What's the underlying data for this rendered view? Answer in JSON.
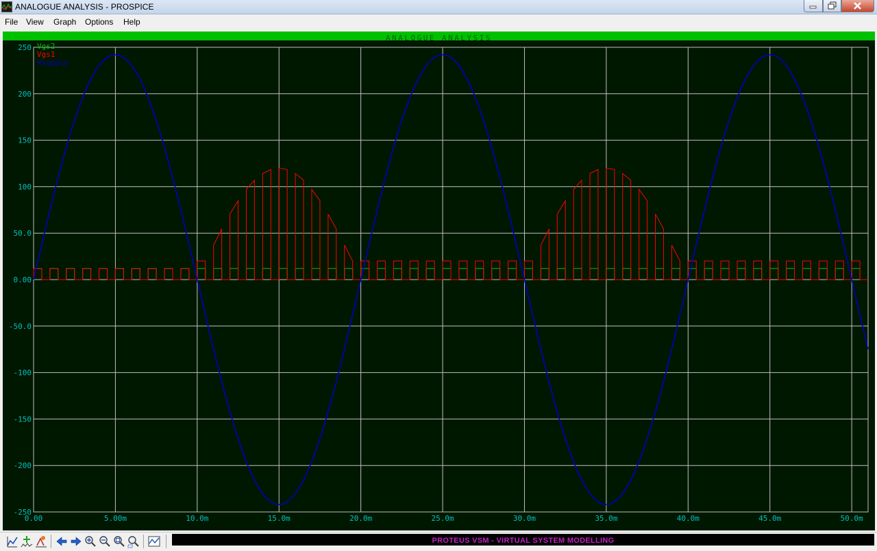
{
  "window": {
    "title": "ANALOGUE ANALYSIS - PROSPICE",
    "controls": [
      "minimize",
      "maximize",
      "close"
    ]
  },
  "menu": [
    "File",
    "View",
    "Graph",
    "Options",
    "Help"
  ],
  "graph": {
    "header_title": "ANALOGUE ANALYSIS",
    "background_color": "#001800",
    "grid_color": "#c0c0c0",
    "axis_label_color": "#00c0c0"
  },
  "chart_data": {
    "type": "line",
    "title": "ANALOGUE ANALYSIS",
    "xlabel": "",
    "ylabel": "",
    "xlim": [
      0,
      0.051
    ],
    "ylim": [
      -250,
      250
    ],
    "grid": true,
    "legend_position": "top-left",
    "x_tick_values": [
      0,
      0.005,
      0.01,
      0.015,
      0.02,
      0.025,
      0.03,
      0.035,
      0.04,
      0.045,
      0.05
    ],
    "x_tick_labels": [
      "0.00",
      "5.00m",
      "10.0m",
      "15.0m",
      "20.0m",
      "25.0m",
      "30.0m",
      "35.0m",
      "40.0m",
      "45.0m",
      "50.0m"
    ],
    "y_tick_values": [
      250,
      200,
      150,
      100,
      50,
      0,
      -50,
      -100,
      -150,
      -200,
      -250
    ],
    "y_tick_labels": [
      "250",
      "200",
      "150",
      "100",
      "50.0",
      "0.00",
      "-50.0",
      "-100",
      "-150",
      "-200",
      "-250"
    ],
    "series": [
      {
        "name": "Vgs2",
        "color": "#00c000",
        "kind": "pwm",
        "frequency_hz": 1000,
        "period_s": 0.001,
        "duty": 0.5,
        "high_value": 12,
        "low_value": 0
      },
      {
        "name": "Vgs1",
        "color": "#ff0000",
        "kind": "pwm_modulated",
        "pwm_period_s": 0.001,
        "duty": 0.5,
        "low_value": 0,
        "envelope": "max(20, 120 * |sin(2*pi*50*t)|) during negative half-cycles of the supply, 20 during positive half-cycles, 12 before 10ms",
        "initial_high_value": 12,
        "steady_high_value": 20,
        "peak_value": 120
      },
      {
        "name": "Vsupply",
        "color": "#0000c0",
        "kind": "sine",
        "amplitude": 242,
        "frequency_hz": 50,
        "offset": 0
      }
    ]
  },
  "toolbar": {
    "icons": [
      "graph-edit-icon",
      "add-trace-icon",
      "simulate-run-icon",
      "arrow-left-icon",
      "arrow-right-icon",
      "zoom-in-icon",
      "zoom-out-icon",
      "zoom-all-icon",
      "zoom-area-icon",
      "graph-icon"
    ]
  },
  "status": {
    "text": "PROTEUS VSM - VIRTUAL SYSTEM MODELLING",
    "text_color": "#c020c0"
  }
}
